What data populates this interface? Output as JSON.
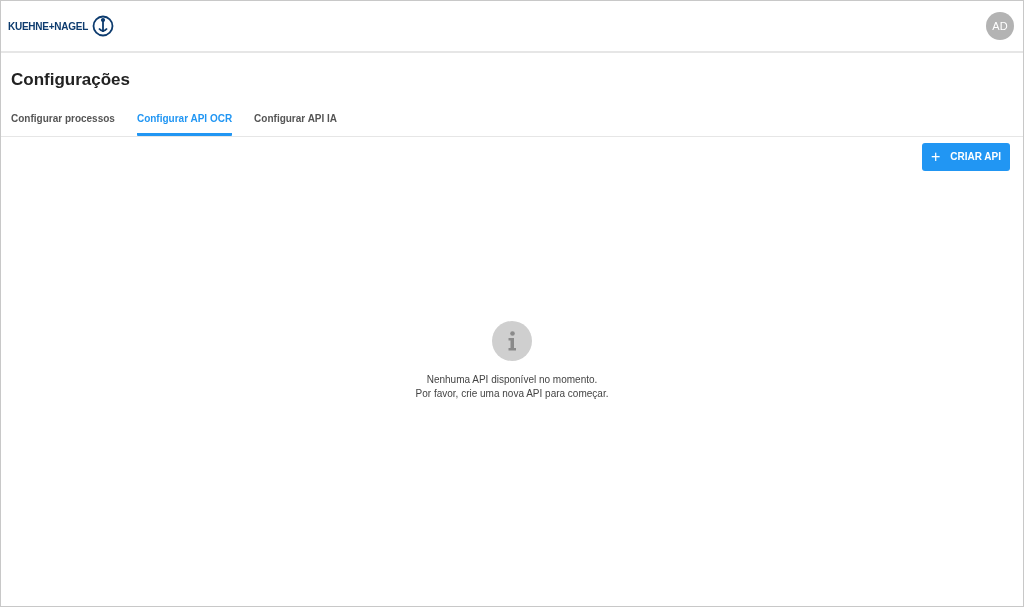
{
  "header": {
    "logo_text": "KUEHNE+NAGEL",
    "avatar": "AD"
  },
  "page": {
    "title": "Configurações"
  },
  "tabs": [
    {
      "label": "Configurar processos",
      "selected": false
    },
    {
      "label": "Configurar API OCR",
      "selected": true
    },
    {
      "label": "Configurar API IA",
      "selected": false
    }
  ],
  "create_button": {
    "icon": "+",
    "label": "CRIAR API"
  },
  "empty_state": {
    "lines": [
      "Nenhuma API disponível no momento.",
      "Por favor, crie uma nova API para começar."
    ]
  }
}
